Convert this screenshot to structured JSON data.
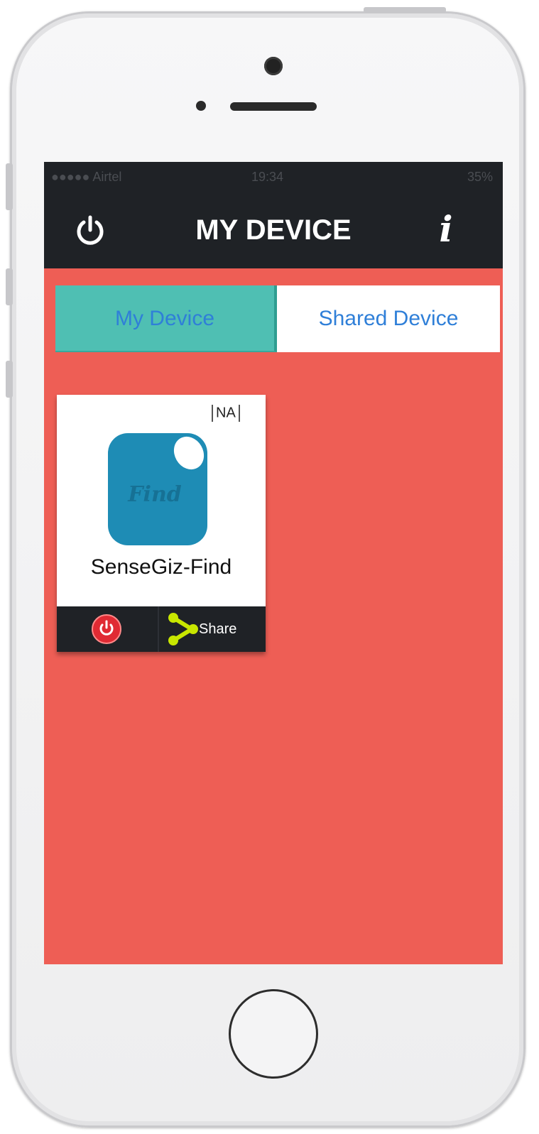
{
  "statusbar": {
    "carrier": "●●●●● Airtel",
    "time": "19:34",
    "battery": "35%"
  },
  "header": {
    "title": "MY DEVICE",
    "info_label": "i",
    "power_icon": "power-icon"
  },
  "tabs": [
    {
      "label": "My Device",
      "active": true
    },
    {
      "label": "Shared Device",
      "active": false
    }
  ],
  "device_card": {
    "status_badge": "NA",
    "name": "SenseGiz-Find",
    "icon_text": "Find",
    "share_label": "Share"
  },
  "colors": {
    "screen_background": "#ee5e55",
    "navbar": "#1f2226",
    "tab_active": "#4fbfb3",
    "tab_text": "#2f7fd8",
    "device_icon": "#1e8cb5",
    "share_icon": "#c8e600",
    "power_red": "#e02a33"
  }
}
